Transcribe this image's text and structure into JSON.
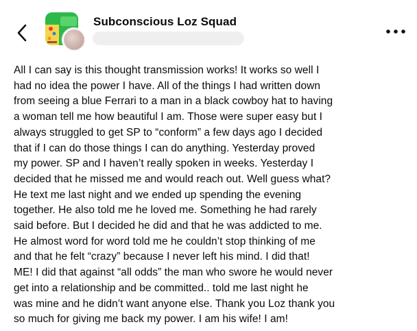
{
  "header": {
    "back_icon": "chevron-left-icon",
    "group_name": "Subconscious Loz Squad",
    "group_icon": "group-cover-icon",
    "author_avatar": "blurred-avatar",
    "author_name_redacted": true,
    "more_icon": "more-horizontal-icon"
  },
  "post": {
    "lines": [
      "All I can say is this thought transmission works! It works so well I",
      "had no idea the power I have. All of the things I had written down",
      "from seeing a blue Ferrari to a man in a black cowboy hat to having",
      "a woman tell me how beautiful I am.  Those were super easy but I",
      "always struggled to get SP to “conform” a few days ago I decided",
      "that if I can do those things I can do anything. Yesterday proved",
      "my power. SP and I haven’t really spoken in weeks. Yesterday I",
      "decided that he missed me and would reach out. Well guess what?",
      "He text me last night and we ended up spending the evening",
      "together. He also told me he loved me. Something he had rarely",
      "said before. But I decided he did and that he was addicted to me.",
      "He almost word for word told me he couldn’t stop thinking of me",
      "and that he felt “crazy” because I never left his mind. I did that!",
      "ME! I did that against “all odds” the man who swore he would never",
      "get into a relationship and be committed.. told me last night he",
      "was mine and he didn’t want anyone else. Thank you Loz thank you",
      "so much for giving me back my power. I am his wife! I am!"
    ]
  },
  "colors": {
    "background": "#ffffff",
    "text": "#0a0a0a",
    "redaction_bar": "#efefef",
    "group_icon_green": "#2fb84a"
  }
}
